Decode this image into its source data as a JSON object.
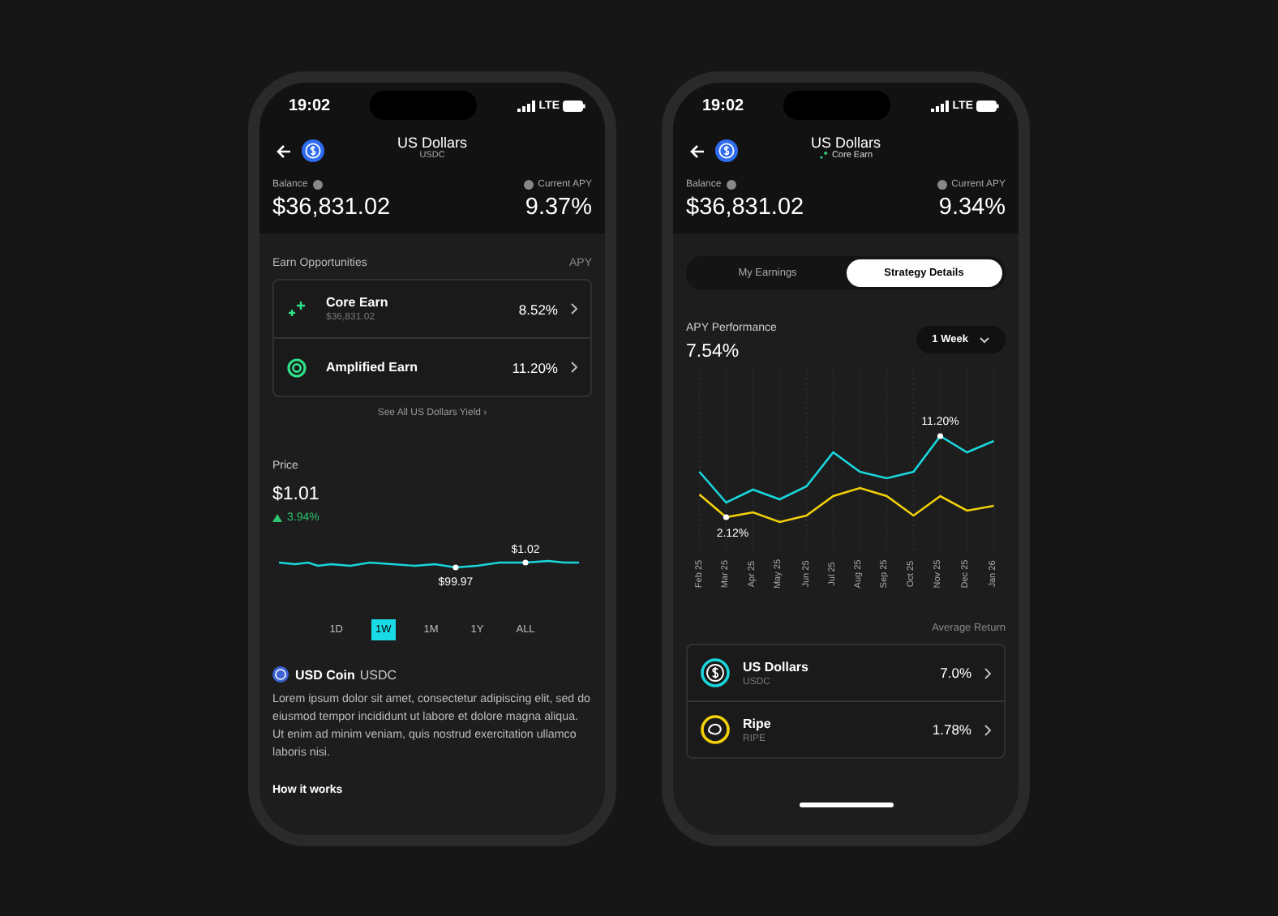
{
  "overview_screen": {
    "status": {
      "time": "19:02",
      "network": "LTE"
    },
    "header": {
      "title": "US Dollars",
      "subtitle": "USDC",
      "subtitle_icon": false
    },
    "balance": {
      "label": "Balance",
      "value": "$36,831.02"
    },
    "apy": {
      "label": "Current APY",
      "value": "9.37%"
    },
    "earn": {
      "title": "Earn Opportunities",
      "column": "APY",
      "items": [
        {
          "kind": "sparkle",
          "name": "Core Earn",
          "sub": "$36,831.02",
          "apy": "8.52%"
        },
        {
          "kind": "ring",
          "name": "Amplified Earn",
          "apy": "11.20%"
        }
      ],
      "link": "See All US Dollars Yield ›"
    },
    "price": {
      "title": "Price",
      "value": "$1.01",
      "change": "3.94%",
      "low_label": "$99.97",
      "high_label": "$1.02"
    },
    "ranges": [
      {
        "label": "1D",
        "selected": false
      },
      {
        "label": "1W",
        "selected": true
      },
      {
        "label": "1M",
        "selected": false
      },
      {
        "label": "1Y",
        "selected": false
      },
      {
        "label": "ALL",
        "selected": false
      }
    ],
    "about": {
      "name": "USD Coin",
      "ticker": "USDC",
      "text": "Lorem ipsum dolor sit amet, consectetur adipiscing elit, sed do eiusmod tempor incididunt ut labore et dolore magna aliqua. Ut enim ad minim veniam, quis nostrud exercitation ullamco laboris nisi."
    },
    "how_title": "How it works"
  },
  "strategy_screen": {
    "status": {
      "time": "19:02",
      "network": "LTE"
    },
    "header": {
      "title": "US Dollars",
      "subtitle": "Core Earn",
      "subtitle_icon": true
    },
    "balance": {
      "label": "Balance",
      "value": "$36,831.02"
    },
    "apy": {
      "label": "Current APY",
      "value": "9.34%"
    },
    "tabs": [
      {
        "label": "My Earnings",
        "selected": false
      },
      {
        "label": "Strategy Details",
        "selected": true
      }
    ],
    "performance": {
      "title": "APY Performance",
      "value": "7.54%",
      "period": "1 Week",
      "high_label": "11.20%",
      "low_label": "2.12%",
      "months": [
        "Feb 25",
        "Mar 25",
        "Apr 25",
        "May 25",
        "Jun 25",
        "Jul 25",
        "Aug 25",
        "Sep 25",
        "Oct 25",
        "Nov 25",
        "Dec 25",
        "Jan 26"
      ]
    },
    "returns": {
      "title": "Average Return",
      "items": [
        {
          "kind": "dollar",
          "name": "US Dollars",
          "ticker": "USDC",
          "value": "7.0%",
          "color": "#19d6dc"
        },
        {
          "kind": "loop",
          "name": "Ripe",
          "ticker": "RIPE",
          "value": "1.78%",
          "color": "#f2d00a"
        }
      ]
    }
  }
}
